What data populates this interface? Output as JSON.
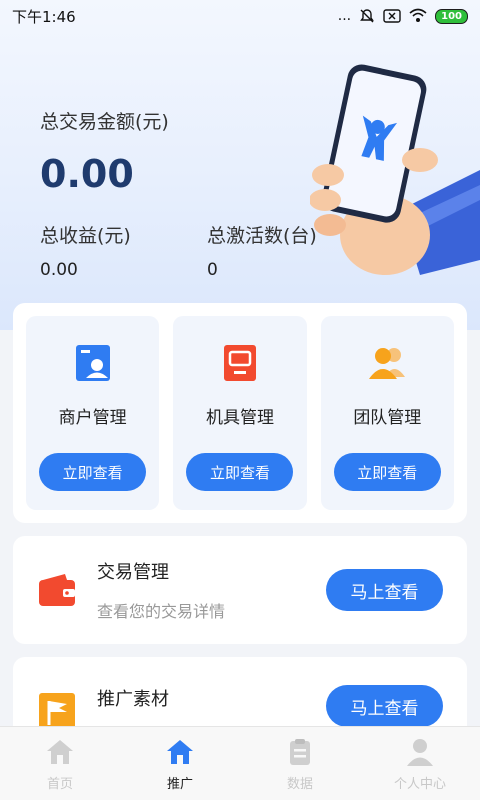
{
  "status_bar": {
    "time": "下午1:46",
    "dots": "...",
    "battery": "100"
  },
  "summary": {
    "total_amount_label": "总交易金额(元)",
    "total_amount_value": "0.00",
    "total_income_label": "总收益(元)",
    "total_income_value": "0.00",
    "total_activations_label": "总激活数(台)",
    "total_activations_value": "0"
  },
  "management": {
    "tiles": [
      {
        "label": "商户管理",
        "button": "立即查看",
        "icon": "merchant-card-icon",
        "color": "#2f7cf2"
      },
      {
        "label": "机具管理",
        "button": "立即查看",
        "icon": "pos-terminal-icon",
        "color": "#f24a2f"
      },
      {
        "label": "团队管理",
        "button": "立即查看",
        "icon": "team-icon",
        "color": "#f7a31c"
      }
    ]
  },
  "trade": {
    "title": "交易管理",
    "subtitle": "查看您的交易详情",
    "button": "马上查看",
    "icon": "wallet-icon"
  },
  "promo": {
    "title": "推广素材",
    "subtitle": "",
    "button": "马上查看",
    "icon": "flag-icon"
  },
  "tabbar": {
    "tabs": [
      {
        "label": "首页",
        "icon": "home-icon",
        "active": false
      },
      {
        "label": "推广",
        "icon": "home-icon",
        "active": true
      },
      {
        "label": "数据",
        "icon": "clipboard-icon",
        "active": false
      },
      {
        "label": "个人中心",
        "icon": "user-icon",
        "active": false
      }
    ]
  },
  "colors": {
    "accent": "#2f7cf2",
    "amount": "#1f3b6e"
  }
}
